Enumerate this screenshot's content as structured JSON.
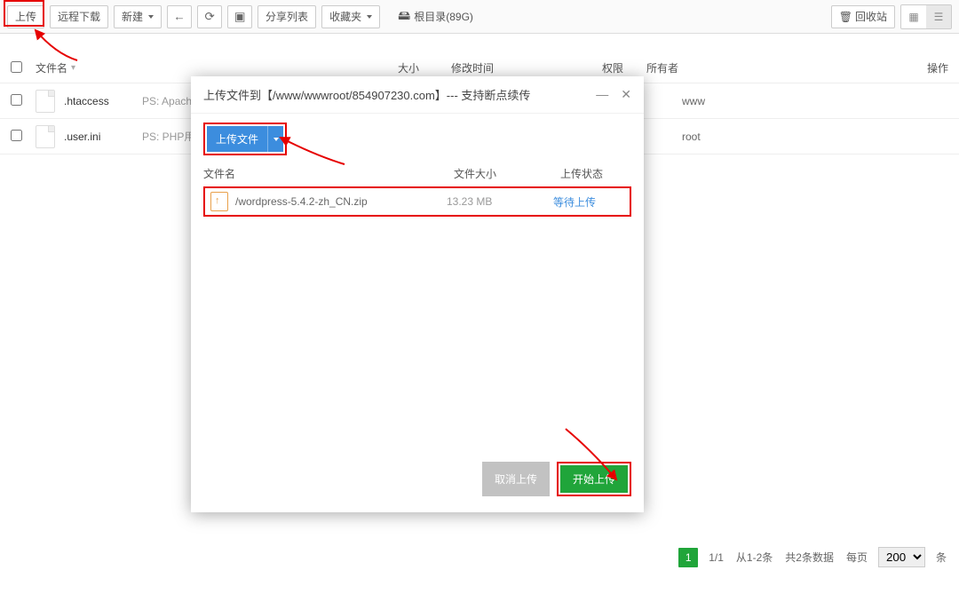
{
  "toolbar": {
    "upload": "上传",
    "remote_download": "远程下载",
    "new": "新建",
    "share_list": "分享列表",
    "favorites": "收藏夹",
    "breadcrumb_label": "根目录(89G)",
    "recycle_bin": "回收站"
  },
  "table": {
    "headers": {
      "filename": "文件名",
      "size": "大小",
      "mtime": "修改时间",
      "perm": "权限",
      "owner": "所有者",
      "action": "操作"
    },
    "rows": [
      {
        "name": ".htaccess",
        "note": "PS: Apache用户",
        "owner": "www"
      },
      {
        "name": ".user.ini",
        "note": "PS: PHP用户配置",
        "owner": "root"
      }
    ]
  },
  "modal": {
    "title": "上传文件到【/www/wwwroot/854907230.com】--- 支持断点续传",
    "upload_file_btn": "上传文件",
    "cols": {
      "name": "文件名",
      "size": "文件大小",
      "status": "上传状态"
    },
    "file": {
      "name": "/wordpress-5.4.2-zh_CN.zip",
      "size": "13.23 MB",
      "status": "等待上传"
    },
    "cancel": "取消上传",
    "start": "开始上传"
  },
  "pagination": {
    "current": "1",
    "pages": "1/1",
    "range": "从1-2条",
    "total": "共2条数据",
    "per_page_label": "每页",
    "per_page_value": "200",
    "unit": "条"
  }
}
